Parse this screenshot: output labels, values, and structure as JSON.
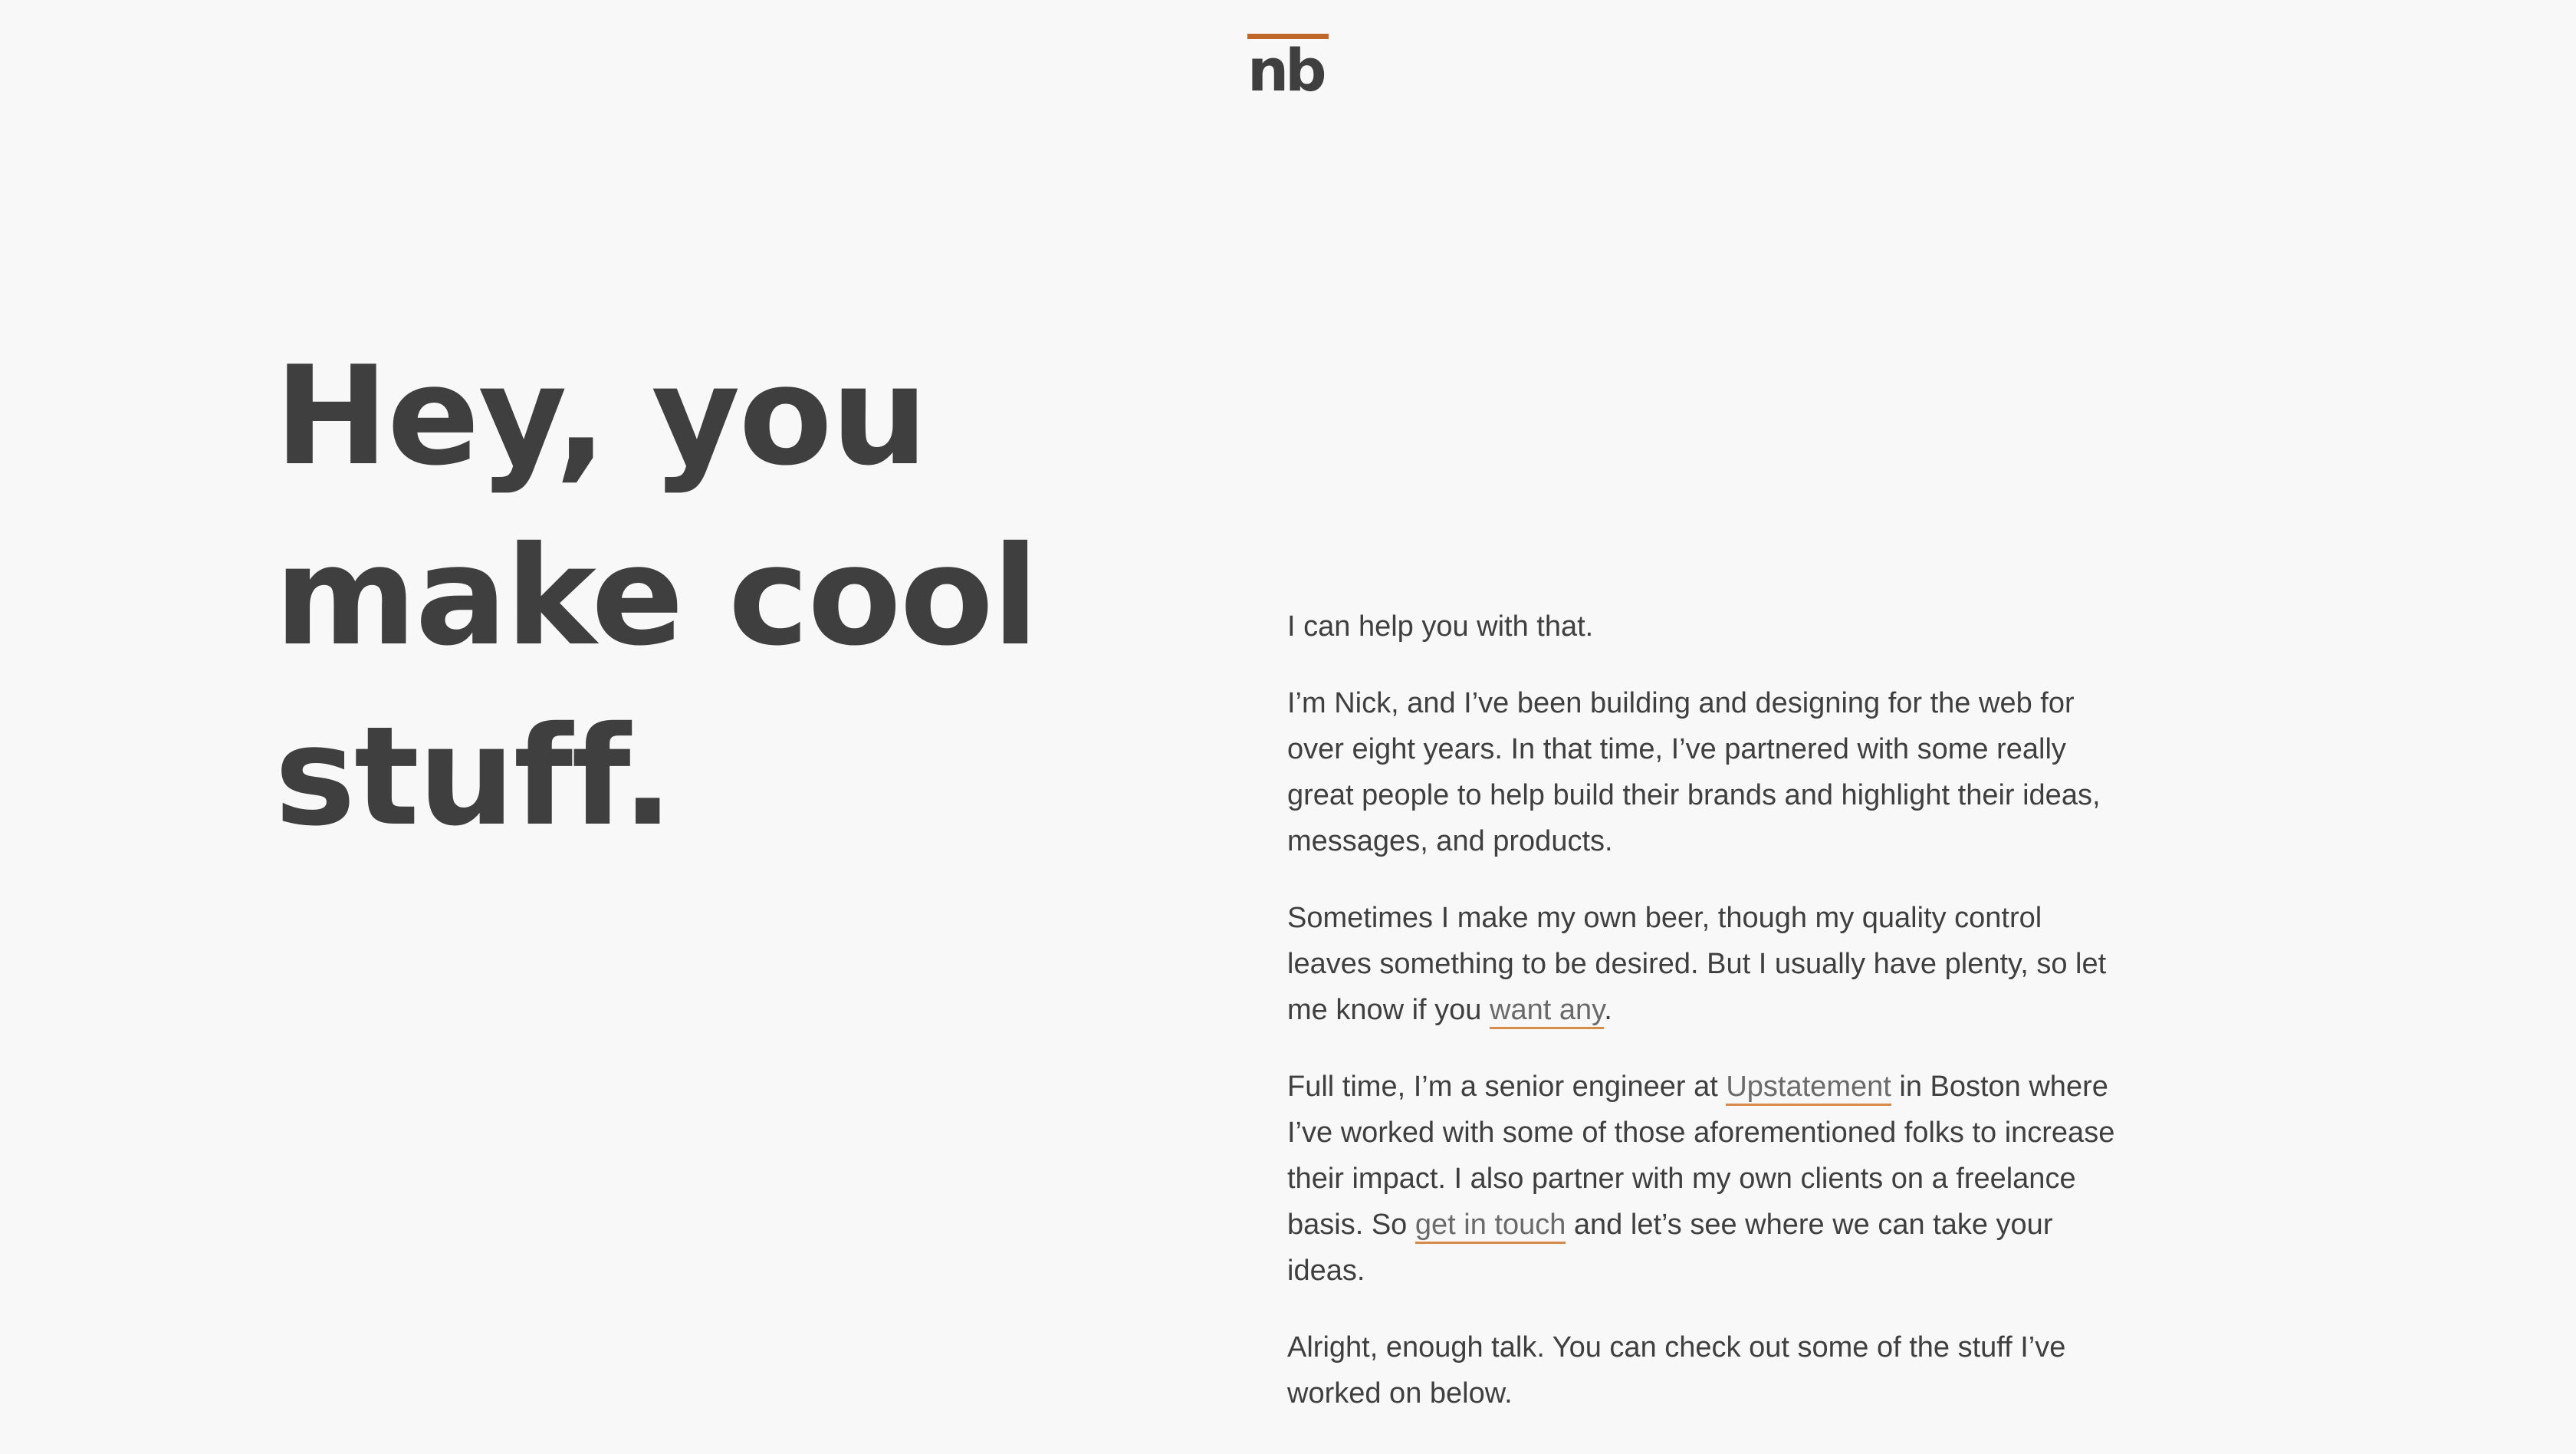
{
  "logo": {
    "text": "nb",
    "accent_color": "#c0682c"
  },
  "hero": {
    "line1": "Hey, you",
    "line2": "make cool",
    "line3": "stuff."
  },
  "intro": {
    "p1": "I can help you with that.",
    "p2": "I’m Nick, and I’ve been building and designing for the web for over eight years. In that time, I’ve partnered with some really great people to help build their brands and highlight their ideas, messages, and products.",
    "p3_before": "Sometimes I make my own beer, though my quality control leaves something to be desired. But I usually have plenty, so let me know if you ",
    "p3_link": "want any",
    "p3_after": ".",
    "p4_before": "Full time, I’m a senior engineer at ",
    "p4_link1": "Upstatement",
    "p4_middle": " in Boston where I’ve worked with some of those aforementioned folks to increase their impact. I also partner with my own clients on a freelance basis. So ",
    "p4_link2": "get in touch",
    "p4_after": " and let’s see where we can take your ideas.",
    "p5": "Alright, enough talk. You can check out some of the stuff I’ve worked on below."
  },
  "colors": {
    "background": "#f8f8f8",
    "text": "#3f3f3f",
    "link_underline": "#d88a4a"
  }
}
